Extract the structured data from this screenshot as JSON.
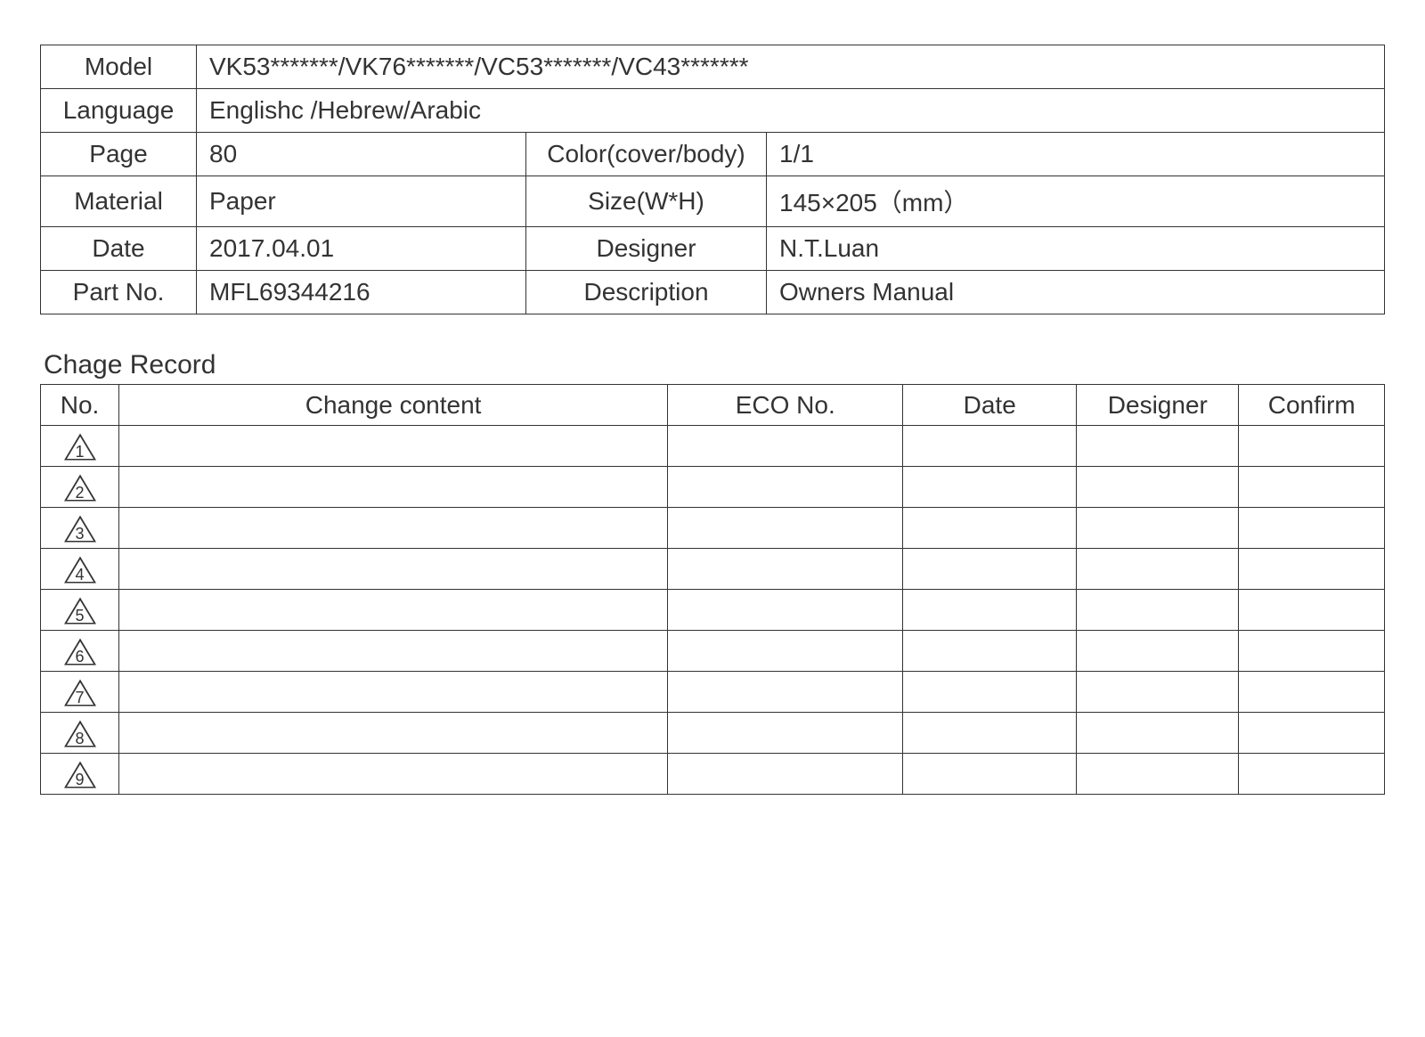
{
  "spec": {
    "model_label": "Model",
    "model_value": "VK53*******/VK76*******/VC53*******/VC43*******",
    "language_label": "Language",
    "language_value": "Englishc  /Hebrew/Arabic",
    "page_label": "Page",
    "page_value": "80",
    "color_label": "Color(cover/body)",
    "color_value": "1/1",
    "material_label": "Material",
    "material_value": "Paper",
    "size_label": "Size(W*H)",
    "size_value": "145×205（mm）",
    "date_label": "Date",
    "date_value": "2017.04.01",
    "designer_label": "Designer",
    "designer_value": "N.T.Luan",
    "partno_label": "Part No.",
    "partno_value": "MFL69344216",
    "description_label": "Description",
    "description_value": "Owners Manual"
  },
  "change_record": {
    "title": "Chage Record",
    "headers": {
      "no": "No.",
      "content": "Change content",
      "eco": "ECO No.",
      "date": "Date",
      "designer": "Designer",
      "confirm": "Confirm"
    },
    "rows": [
      {
        "no": "1",
        "content": "",
        "eco": "",
        "date": "",
        "designer": "",
        "confirm": ""
      },
      {
        "no": "2",
        "content": "",
        "eco": "",
        "date": "",
        "designer": "",
        "confirm": ""
      },
      {
        "no": "3",
        "content": "",
        "eco": "",
        "date": "",
        "designer": "",
        "confirm": ""
      },
      {
        "no": "4",
        "content": "",
        "eco": "",
        "date": "",
        "designer": "",
        "confirm": ""
      },
      {
        "no": "5",
        "content": "",
        "eco": "",
        "date": "",
        "designer": "",
        "confirm": ""
      },
      {
        "no": "6",
        "content": "",
        "eco": "",
        "date": "",
        "designer": "",
        "confirm": ""
      },
      {
        "no": "7",
        "content": "",
        "eco": "",
        "date": "",
        "designer": "",
        "confirm": ""
      },
      {
        "no": "8",
        "content": "",
        "eco": "",
        "date": "",
        "designer": "",
        "confirm": ""
      },
      {
        "no": "9",
        "content": "",
        "eco": "",
        "date": "",
        "designer": "",
        "confirm": ""
      }
    ]
  }
}
